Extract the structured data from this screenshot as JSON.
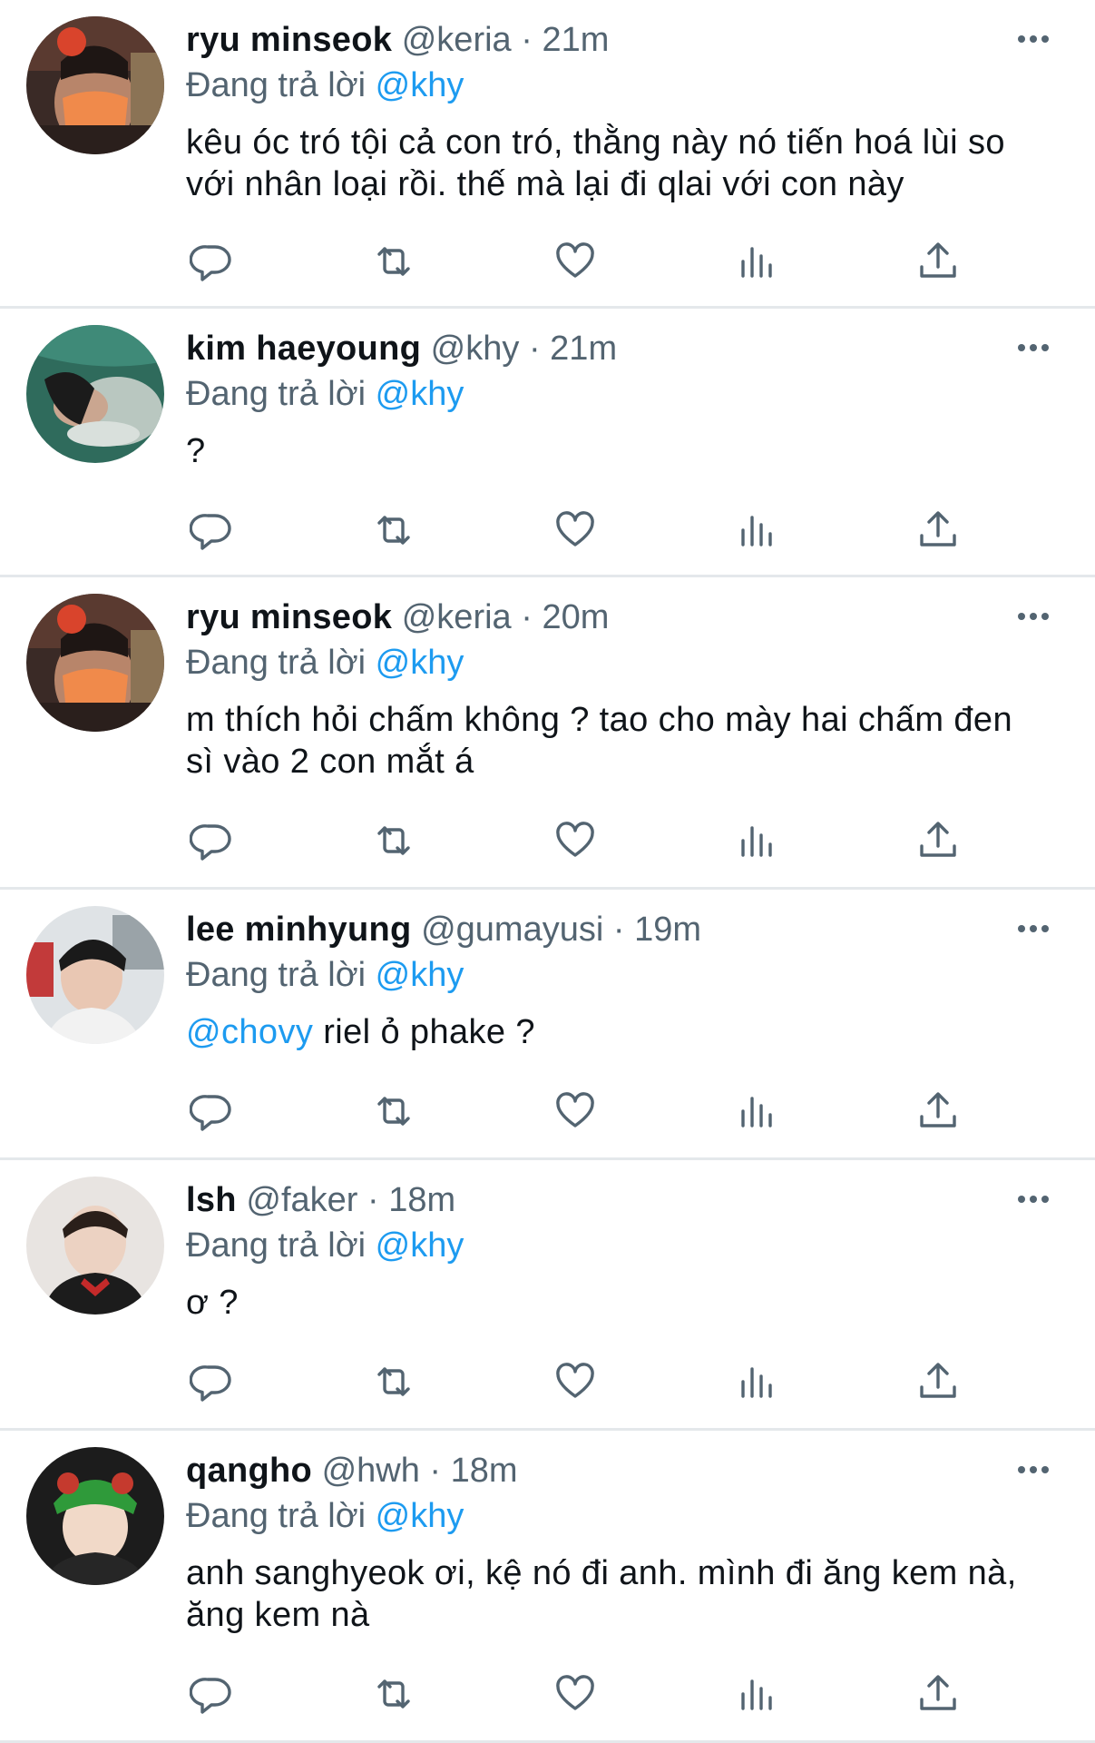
{
  "replying_prefix": "Đang trả lời ",
  "tweets": [
    {
      "name": "ryu minseok",
      "handle": "@keria",
      "time": "21m",
      "reply_to": "@khy",
      "text_lines": [
        "kêu óc tró tội cả con tró, thằng này nó tiến hoá lùi so",
        "với nhân loại rồi. thế mà lại đi qlai với con này"
      ]
    },
    {
      "name": "kim haeyoung",
      "handle": "@khy",
      "time": "21m",
      "reply_to": "@khy",
      "text_lines": [
        "?"
      ]
    },
    {
      "name": "ryu minseok",
      "handle": "@keria",
      "time": "20m",
      "reply_to": "@khy",
      "text_lines": [
        "m thích hỏi chấm không ? tao cho mày hai chấm đen",
        "sì vào 2 con mắt á"
      ]
    },
    {
      "name": "lee minhyung",
      "handle": "@gumayusi",
      "time": "19m",
      "reply_to": "@khy",
      "mention": "@chovy",
      "text_rest": " riel ỏ phake ?"
    },
    {
      "name": "lsh",
      "handle": "@faker",
      "time": "18m",
      "reply_to": "@khy",
      "text_lines": [
        "ơ ?"
      ]
    },
    {
      "name": "qangho",
      "handle": "@hwh",
      "time": "18m",
      "reply_to": "@khy",
      "text_lines": [
        "anh sanghyeok ơi, kệ nó đi anh. mình đi ăng kem nà,",
        "ăng kem nà"
      ]
    }
  ],
  "separator": " · ",
  "icons": {
    "reply": "reply-icon",
    "retweet": "retweet-icon",
    "like": "like-icon",
    "views": "views-icon",
    "share": "share-icon",
    "more": "more-icon"
  },
  "colors": {
    "text": "#0f1419",
    "muted": "#536471",
    "accent": "#1d9bf0",
    "divider": "#e4e8eb"
  }
}
